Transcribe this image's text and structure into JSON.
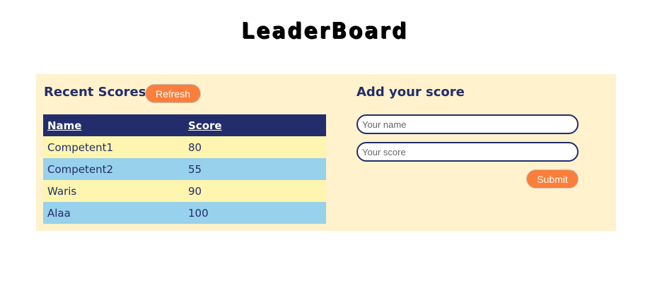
{
  "page": {
    "title": "LeaderBoard"
  },
  "recent_scores": {
    "title": "Recent Scores",
    "refresh_label": "Refresh",
    "table": {
      "headers": {
        "name": "Name",
        "score": "Score"
      },
      "rows": [
        {
          "name": "Competent1",
          "score": "80"
        },
        {
          "name": "Competent2",
          "score": "55"
        },
        {
          "name": "Waris",
          "score": "90"
        },
        {
          "name": "Alaa",
          "score": "100"
        }
      ]
    }
  },
  "add_score": {
    "title": "Add your score",
    "name_placeholder": "Your name",
    "score_placeholder": "Your score",
    "submit_label": "Submit"
  },
  "colors": {
    "panel_bg": "#fff2cc",
    "navy": "#232d6b",
    "accent": "#fb7e3a",
    "row_yellow": "#fdf5b0",
    "row_blue": "#98d1eb"
  }
}
